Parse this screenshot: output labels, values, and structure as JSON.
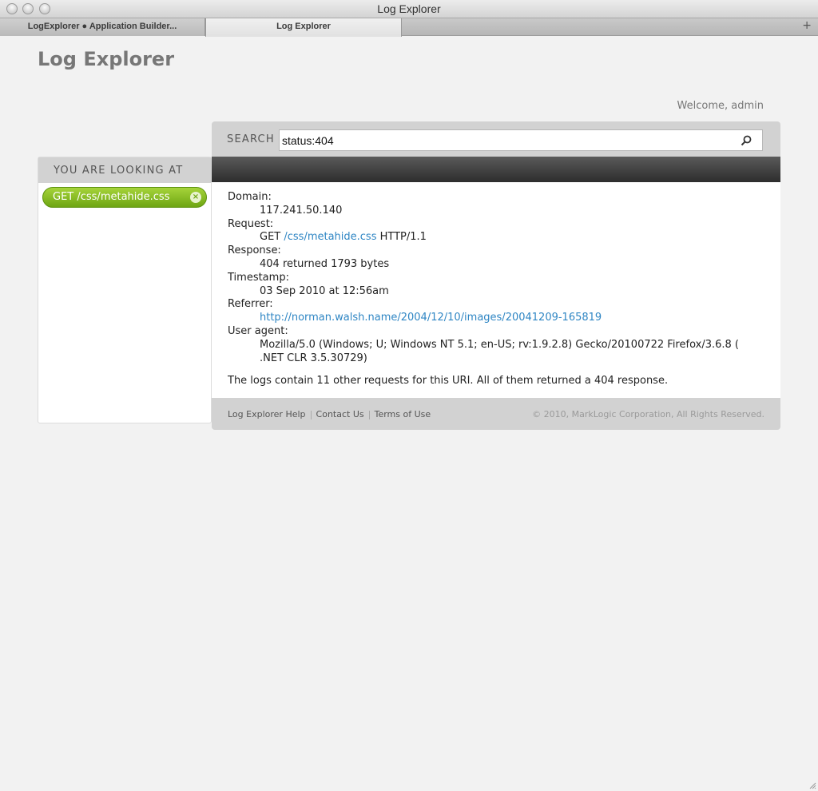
{
  "window": {
    "title": "Log Explorer",
    "tabs": [
      {
        "label": "LogExplorer ● Application Builder..."
      },
      {
        "label": "Log Explorer"
      }
    ],
    "add_tab": "+"
  },
  "page": {
    "title": "Log Explorer",
    "welcome": "Welcome, admin"
  },
  "sidebar": {
    "heading": "YOU ARE LOOKING AT",
    "filter": {
      "label": "GET /css/metahide.css",
      "close": "×"
    }
  },
  "search": {
    "label": "SEARCH",
    "value": "status:404"
  },
  "details": {
    "domain_label": "Domain:",
    "domain": "117.241.50.140",
    "request_label": "Request:",
    "request_method": "GET",
    "request_path": "/css/metahide.css",
    "request_protocol": "HTTP/1.1",
    "response_label": "Response:",
    "response": "404 returned 1793 bytes",
    "timestamp_label": "Timestamp:",
    "timestamp": "03 Sep 2010 at 12:56am",
    "referrer_label": "Referrer:",
    "referrer": "http://norman.walsh.name/2004/12/10/images/20041209-165819",
    "user_agent_label": "User agent:",
    "user_agent": "Mozilla/5.0 (Windows; U; Windows NT 5.1; en-US; rv:1.9.2.8) Gecko/20100722 Firefox/3.6.8 ( .NET CLR 3.5.30729)",
    "summary": "The logs contain 11 other requests for this URI. All of them returned a 404 response."
  },
  "footer": {
    "help": "Log Explorer Help",
    "contact": "Contact Us",
    "terms": "Terms of Use",
    "copyright": "© 2010, MarkLogic Corporation, All Rights Reserved."
  },
  "colors": {
    "accent_green": "#7fb71f",
    "link_blue": "#2f86c4"
  }
}
